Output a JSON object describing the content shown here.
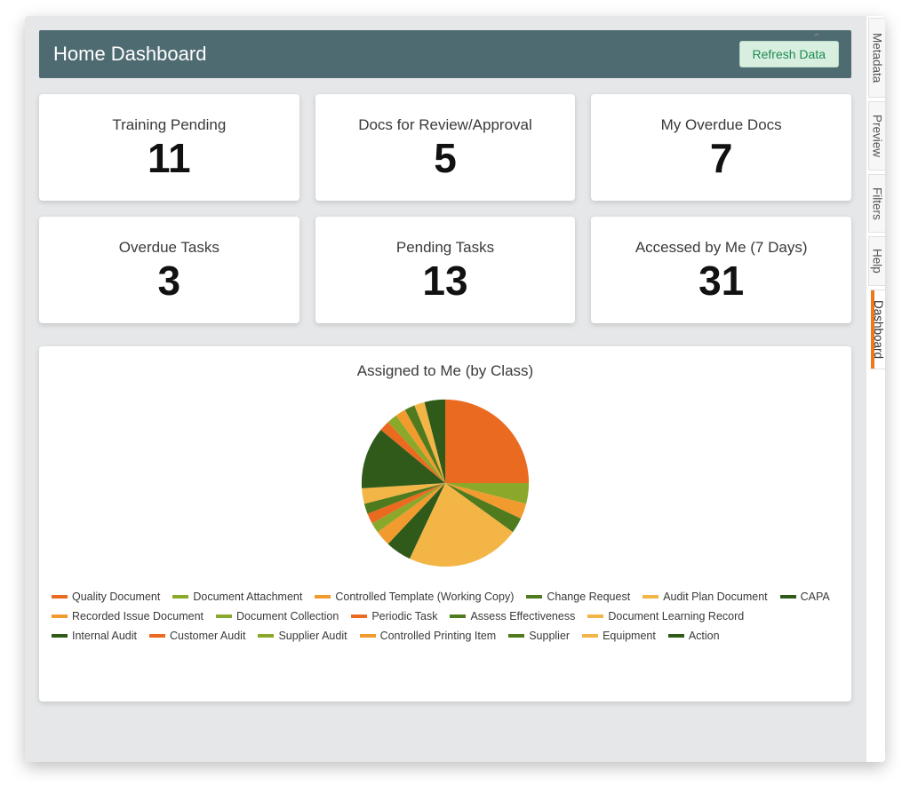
{
  "header": {
    "title": "Home Dashboard",
    "refresh_label": "Refresh Data"
  },
  "cards": [
    {
      "title": "Training Pending",
      "value": "11"
    },
    {
      "title": "Docs for Review/Approval",
      "value": "5"
    },
    {
      "title": "My Overdue Docs",
      "value": "7"
    },
    {
      "title": "Overdue Tasks",
      "value": "3"
    },
    {
      "title": "Pending Tasks",
      "value": "13"
    },
    {
      "title": "Accessed by Me (7 Days)",
      "value": "31"
    }
  ],
  "chart": {
    "title": "Assigned to Me (by Class)",
    "legend": [
      {
        "label": "Quality Document",
        "color": "#ea6a1f"
      },
      {
        "label": "Document Attachment",
        "color": "#8aa92a"
      },
      {
        "label": "Controlled Template (Working Copy)",
        "color": "#f19a2e"
      },
      {
        "label": "Change Request",
        "color": "#4f7a1e"
      },
      {
        "label": "Audit Plan Document",
        "color": "#f3b546"
      },
      {
        "label": "CAPA",
        "color": "#2f5a1a"
      },
      {
        "label": "Recorded Issue Document",
        "color": "#f19a2e"
      },
      {
        "label": "Document Collection",
        "color": "#8aa92a"
      },
      {
        "label": "Periodic Task",
        "color": "#ea6a1f"
      },
      {
        "label": "Assess Effectiveness",
        "color": "#4f7a1e"
      },
      {
        "label": "Document Learning Record",
        "color": "#f3b546"
      },
      {
        "label": "Internal Audit",
        "color": "#2f5a1a"
      },
      {
        "label": "Customer Audit",
        "color": "#ea6a1f"
      },
      {
        "label": "Supplier Audit",
        "color": "#8aa92a"
      },
      {
        "label": "Controlled Printing Item",
        "color": "#f19a2e"
      },
      {
        "label": "Supplier",
        "color": "#4f7a1e"
      },
      {
        "label": "Equipment",
        "color": "#f3b546"
      },
      {
        "label": "Action",
        "color": "#2f5a1a"
      }
    ]
  },
  "side_tabs": [
    {
      "label": "Metadata",
      "active": false
    },
    {
      "label": "Preview",
      "active": false
    },
    {
      "label": "Filters",
      "active": false
    },
    {
      "label": "Help",
      "active": false
    },
    {
      "label": "Dashboard",
      "active": true
    }
  ],
  "chart_data": {
    "type": "pie",
    "title": "Assigned to Me (by Class)",
    "series": [
      {
        "name": "Quality Document",
        "value": 25,
        "color": "#ea6a1f"
      },
      {
        "name": "Document Attachment",
        "value": 4,
        "color": "#8aa92a"
      },
      {
        "name": "Controlled Template (Working Copy)",
        "value": 3,
        "color": "#f19a2e"
      },
      {
        "name": "Change Request",
        "value": 3,
        "color": "#4f7a1e"
      },
      {
        "name": "Audit Plan Document",
        "value": 22,
        "color": "#f3b546"
      },
      {
        "name": "CAPA",
        "value": 5,
        "color": "#2f5a1a"
      },
      {
        "name": "Recorded Issue Document",
        "value": 3,
        "color": "#f19a2e"
      },
      {
        "name": "Document Collection",
        "value": 2,
        "color": "#8aa92a"
      },
      {
        "name": "Periodic Task",
        "value": 2,
        "color": "#ea6a1f"
      },
      {
        "name": "Assess Effectiveness",
        "value": 2,
        "color": "#4f7a1e"
      },
      {
        "name": "Document Learning Record",
        "value": 3,
        "color": "#f3b546"
      },
      {
        "name": "Internal Audit",
        "value": 12,
        "color": "#2f5a1a"
      },
      {
        "name": "Customer Audit",
        "value": 2,
        "color": "#ea6a1f"
      },
      {
        "name": "Supplier Audit",
        "value": 2,
        "color": "#8aa92a"
      },
      {
        "name": "Controlled Printing Item",
        "value": 2,
        "color": "#f19a2e"
      },
      {
        "name": "Supplier",
        "value": 2,
        "color": "#4f7a1e"
      },
      {
        "name": "Equipment",
        "value": 2,
        "color": "#f3b546"
      },
      {
        "name": "Action",
        "value": 4,
        "color": "#2f5a1a"
      }
    ]
  }
}
